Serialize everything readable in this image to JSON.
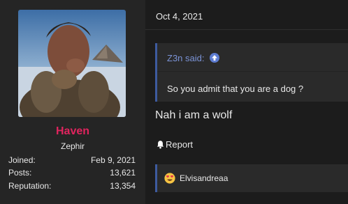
{
  "user": {
    "name": "Haven",
    "title": "Zephir",
    "stats": [
      {
        "label": "Joined:",
        "value": "Feb 9, 2021"
      },
      {
        "label": "Posts:",
        "value": "13,621"
      },
      {
        "label": "Reputation:",
        "value": "13,354"
      }
    ]
  },
  "post": {
    "date": "Oct 4, 2021",
    "quote": {
      "author_label": "Z3n said:",
      "text": "So you admit that you are a dog ?"
    },
    "message": "Nah i am a wolf",
    "report_label": "Report",
    "reactions": {
      "users": "Elvisandreaa"
    }
  },
  "colors": {
    "username": "#e0245e",
    "accent": "#3e5b9f",
    "quote_author": "#7b93d6"
  }
}
